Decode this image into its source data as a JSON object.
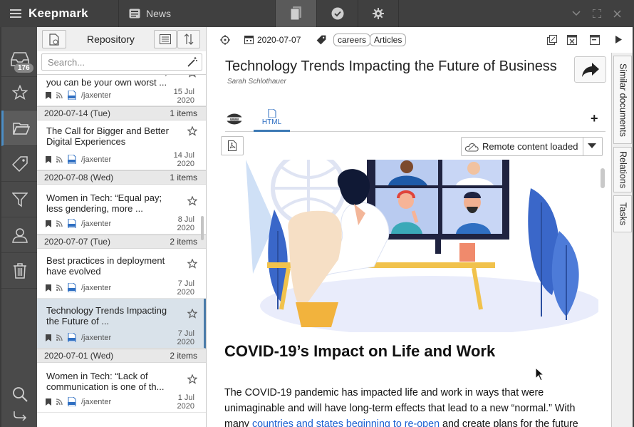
{
  "app": {
    "name": "Keepmark",
    "section": "News"
  },
  "sidebar": {
    "inbox_count": "176"
  },
  "list": {
    "title": "Repository",
    "search_placeholder": "Search...",
    "partial_item": {
      "title": "Women in Tech: \"Sometimes, you can be your own worst ...",
      "source": "/jaxenter",
      "date_day": "15 Jul",
      "date_year": "2020"
    },
    "groups": [
      {
        "date": "2020-07-14 (Tue)",
        "count": "1 items",
        "items": [
          {
            "title": "The Call for Bigger and Better Digital Experiences",
            "source": "/jaxenter",
            "date_day": "14 Jul",
            "date_year": "2020"
          }
        ]
      },
      {
        "date": "2020-07-08 (Wed)",
        "count": "1 items",
        "items": [
          {
            "title": "Women in Tech: “Equal pay; less gendering, more ...",
            "source": "/jaxenter",
            "date_day": "8 Jul",
            "date_year": "2020"
          }
        ]
      },
      {
        "date": "2020-07-07 (Tue)",
        "count": "2 items",
        "items": [
          {
            "title": "Best practices in deployment have evolved",
            "source": "/jaxenter",
            "date_day": "7 Jul",
            "date_year": "2020"
          },
          {
            "title": "Technology Trends Impacting the Future of ...",
            "source": "/jaxenter",
            "date_day": "7 Jul",
            "date_year": "2020"
          }
        ]
      },
      {
        "date": "2020-07-01 (Wed)",
        "count": "2 items",
        "items": [
          {
            "title": "Women in Tech: “Lack of communication is one of th...",
            "source": "/jaxenter",
            "date_day": "1 Jul",
            "date_year": "2020"
          }
        ]
      }
    ]
  },
  "detail": {
    "date": "2020-07-07",
    "tags": [
      "careers",
      "Articles"
    ],
    "title": "Technology Trends Impacting the Future of Business",
    "author": "Sarah Schlothauer",
    "view_tab_html": "HTML",
    "remote_label": "Remote content loaded",
    "heading": "COVID-19’s Impact on Life and Work",
    "para_1": "The COVID-19 pandemic has impacted life and work in ways that were unimaginable and will have long-term effects that lead to a new “normal.” With many ",
    "para_link": "countries and states beginning to re-open",
    "para_2": " and create plans for the future"
  },
  "side_tabs": [
    "Similar documents",
    "Relations",
    "Tasks"
  ],
  "colors": {
    "accent": "#4c8ec6",
    "selected_row": "#d9e2ea",
    "link": "#1a5fd0",
    "titlebar": "#404040"
  }
}
